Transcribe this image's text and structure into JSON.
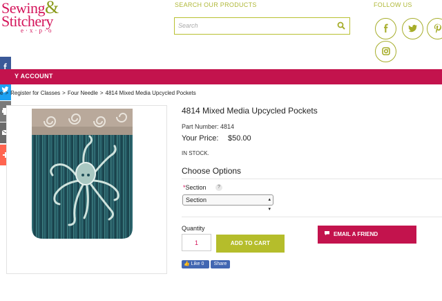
{
  "logo": {
    "line1": "Sewing",
    "amp": "&",
    "line2": "Stitchery",
    "line3": "e·x·p·o"
  },
  "search": {
    "title": "SEARCH OUR PRODUCTS",
    "placeholder": "Search"
  },
  "follow": {
    "title": "FOLLOW US",
    "icons": {
      "facebook": "f",
      "twitter": "t",
      "pinterest": "p",
      "instagram": "ig"
    }
  },
  "nav": {
    "account": "Y ACCOUNT"
  },
  "breadcrumb": {
    "home": "e",
    "sep": ">",
    "classes": "Register for Classes",
    "four_needle": "Four Needle",
    "current": "4814 Mixed Media Upcycled Pockets"
  },
  "product": {
    "title": "4814 Mixed Media Upcycled Pockets",
    "part_number": "Part Number: 4814",
    "price_label": "Your Price:",
    "price": "$50.00",
    "stock": "IN STOCK.",
    "choose_options": "Choose Options",
    "section_label": "Section",
    "required_mark": "*",
    "help": "?",
    "section_value": "Section",
    "quantity_label": "Quantity",
    "quantity_value": "1",
    "add_to_cart": "ADD TO CART",
    "email_friend": "EMAIL A FRIEND"
  },
  "social_buttons": {
    "like": "Like 0",
    "share": "Share"
  },
  "colors": {
    "brand_pink": "#c3134d",
    "accent_green": "#b5bd2b",
    "facebook_blue": "#4267b2"
  }
}
